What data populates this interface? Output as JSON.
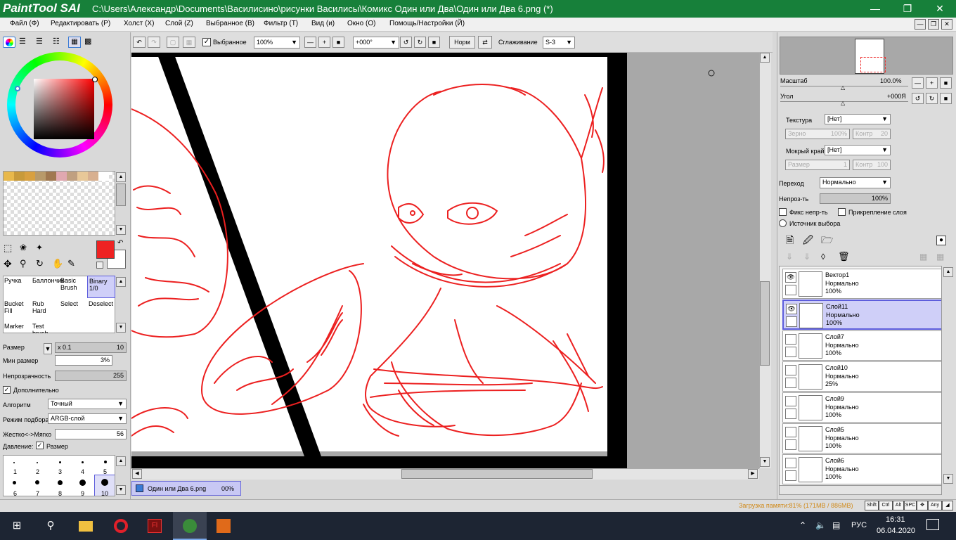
{
  "app": {
    "logo": "PaintTool",
    "logo_suffix": "SAI",
    "title": "C:\\Users\\Александр\\Documents\\Василисино\\рисунки Василисы\\Комикс Один или Два\\Один или Два 6.png (*)"
  },
  "menu": [
    "Файл (Ф)",
    "Редактировать (Р)",
    "Холст (Х)",
    "Слой (Z)",
    "Выбранное (В)",
    "Фильтр (Т)",
    "Вид (и)",
    "Окно (О)",
    "Помощь/Настройки (Й)"
  ],
  "toolbar": {
    "selected_label": "Выбранное",
    "zoom": "100%",
    "angle": "+000°",
    "norm_label": "Норм",
    "smoothing_label": "Сглаживание",
    "smoothing_value": "S-3"
  },
  "tools": {
    "brushes": [
      {
        "label": "Ручка"
      },
      {
        "label": "Баллончик"
      },
      {
        "label": "Basic Brush"
      },
      {
        "label": "Binary 1/0"
      },
      {
        "label": "Bucket Fill"
      },
      {
        "label": "Rub Hard"
      },
      {
        "label": "Select"
      },
      {
        "label": "Deselect"
      },
      {
        "label": "Marker"
      },
      {
        "label": "Test brush"
      }
    ],
    "size_label": "Размер",
    "size_mult": "x 0.1",
    "size_value": "10",
    "min_size_label": "Мин размер",
    "min_size_value": "3%",
    "opacity_label": "Непрозрачность",
    "opacity_value": "255",
    "extra_label": "Дополнительно",
    "algo_label": "Алгоритм",
    "algo_value": "Точный",
    "mode_label": "Режим подбора",
    "mode_value": "ARGB-слой",
    "hardness_label": "Жестко<->Мягко",
    "hardness_value": "56",
    "pressure_label": "Давление:",
    "pressure_size_label": "Размер",
    "brush_sizes": [
      "1",
      "2",
      "3",
      "4",
      "5",
      "6",
      "7",
      "8",
      "9",
      "10"
    ]
  },
  "right": {
    "scale_label": "Масштаб",
    "scale_value": "100.0%",
    "angle_label": "Угол",
    "angle_value": "+000Я",
    "texture_label": "Текстура",
    "texture_value": "[Нет]",
    "grain_label": "Зерно",
    "grain_value": "100%",
    "contrast_label": "Контр",
    "contrast_value": "20",
    "wet_label": "Мокрый край",
    "wet_value": "[Нет]",
    "wsize_label": "Размер",
    "wsize_value": "1",
    "wcontrast_label": "Контр",
    "wcontrast_value": "100",
    "blend_label": "Переход",
    "blend_value": "Нормально",
    "opacity_label": "Непроз-ть",
    "opacity_value": "100%",
    "fix_opacity_label": "Фикс непр-ть",
    "clip_label": "Прикрепление слоя",
    "source_label": "Источник выбора"
  },
  "layers": [
    {
      "name": "Вектор1",
      "mode": "Нормально",
      "opacity": "100%",
      "selected": false
    },
    {
      "name": "Слой11",
      "mode": "Нормально",
      "opacity": "100%",
      "selected": true
    },
    {
      "name": "Слой7",
      "mode": "Нормально",
      "opacity": "100%",
      "selected": false
    },
    {
      "name": "Слой10",
      "mode": "Нормально",
      "opacity": "25%",
      "selected": false
    },
    {
      "name": "Слой9",
      "mode": "Нормально",
      "opacity": "100%",
      "selected": false
    },
    {
      "name": "Слой5",
      "mode": "Нормально",
      "opacity": "100%",
      "selected": false
    },
    {
      "name": "Слой6",
      "mode": "Нормально",
      "opacity": "100%",
      "selected": false
    }
  ],
  "doc_tab": {
    "name": "Один или Два 6.png",
    "zoom": "00%"
  },
  "status": {
    "memory": "Загрузка памяти:81% (171MB / 886MB)",
    "keys": [
      "Shift",
      "Ctrl",
      "Alt",
      "SPC",
      "Any"
    ]
  },
  "taskbar": {
    "lang": "РУС",
    "time": "16:31",
    "date": "06.04.2020"
  },
  "colors": {
    "title_bg": "#17803a",
    "primary": "#ee2222",
    "stroke": "#ec2020"
  }
}
